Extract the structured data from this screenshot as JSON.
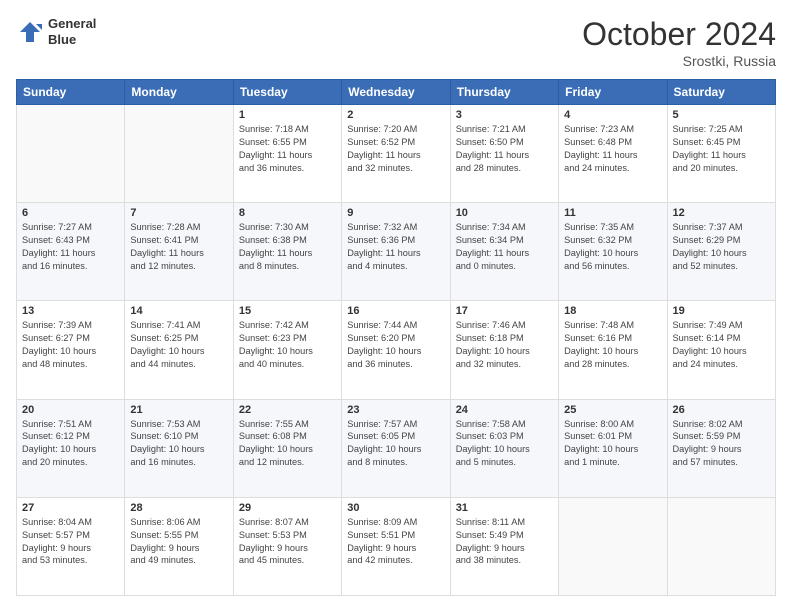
{
  "logo": {
    "line1": "General",
    "line2": "Blue"
  },
  "title": "October 2024",
  "location": "Srostki, Russia",
  "days_header": [
    "Sunday",
    "Monday",
    "Tuesday",
    "Wednesday",
    "Thursday",
    "Friday",
    "Saturday"
  ],
  "weeks": [
    [
      {
        "day": "",
        "info": ""
      },
      {
        "day": "",
        "info": ""
      },
      {
        "day": "1",
        "info": "Sunrise: 7:18 AM\nSunset: 6:55 PM\nDaylight: 11 hours\nand 36 minutes."
      },
      {
        "day": "2",
        "info": "Sunrise: 7:20 AM\nSunset: 6:52 PM\nDaylight: 11 hours\nand 32 minutes."
      },
      {
        "day": "3",
        "info": "Sunrise: 7:21 AM\nSunset: 6:50 PM\nDaylight: 11 hours\nand 28 minutes."
      },
      {
        "day": "4",
        "info": "Sunrise: 7:23 AM\nSunset: 6:48 PM\nDaylight: 11 hours\nand 24 minutes."
      },
      {
        "day": "5",
        "info": "Sunrise: 7:25 AM\nSunset: 6:45 PM\nDaylight: 11 hours\nand 20 minutes."
      }
    ],
    [
      {
        "day": "6",
        "info": "Sunrise: 7:27 AM\nSunset: 6:43 PM\nDaylight: 11 hours\nand 16 minutes."
      },
      {
        "day": "7",
        "info": "Sunrise: 7:28 AM\nSunset: 6:41 PM\nDaylight: 11 hours\nand 12 minutes."
      },
      {
        "day": "8",
        "info": "Sunrise: 7:30 AM\nSunset: 6:38 PM\nDaylight: 11 hours\nand 8 minutes."
      },
      {
        "day": "9",
        "info": "Sunrise: 7:32 AM\nSunset: 6:36 PM\nDaylight: 11 hours\nand 4 minutes."
      },
      {
        "day": "10",
        "info": "Sunrise: 7:34 AM\nSunset: 6:34 PM\nDaylight: 11 hours\nand 0 minutes."
      },
      {
        "day": "11",
        "info": "Sunrise: 7:35 AM\nSunset: 6:32 PM\nDaylight: 10 hours\nand 56 minutes."
      },
      {
        "day": "12",
        "info": "Sunrise: 7:37 AM\nSunset: 6:29 PM\nDaylight: 10 hours\nand 52 minutes."
      }
    ],
    [
      {
        "day": "13",
        "info": "Sunrise: 7:39 AM\nSunset: 6:27 PM\nDaylight: 10 hours\nand 48 minutes."
      },
      {
        "day": "14",
        "info": "Sunrise: 7:41 AM\nSunset: 6:25 PM\nDaylight: 10 hours\nand 44 minutes."
      },
      {
        "day": "15",
        "info": "Sunrise: 7:42 AM\nSunset: 6:23 PM\nDaylight: 10 hours\nand 40 minutes."
      },
      {
        "day": "16",
        "info": "Sunrise: 7:44 AM\nSunset: 6:20 PM\nDaylight: 10 hours\nand 36 minutes."
      },
      {
        "day": "17",
        "info": "Sunrise: 7:46 AM\nSunset: 6:18 PM\nDaylight: 10 hours\nand 32 minutes."
      },
      {
        "day": "18",
        "info": "Sunrise: 7:48 AM\nSunset: 6:16 PM\nDaylight: 10 hours\nand 28 minutes."
      },
      {
        "day": "19",
        "info": "Sunrise: 7:49 AM\nSunset: 6:14 PM\nDaylight: 10 hours\nand 24 minutes."
      }
    ],
    [
      {
        "day": "20",
        "info": "Sunrise: 7:51 AM\nSunset: 6:12 PM\nDaylight: 10 hours\nand 20 minutes."
      },
      {
        "day": "21",
        "info": "Sunrise: 7:53 AM\nSunset: 6:10 PM\nDaylight: 10 hours\nand 16 minutes."
      },
      {
        "day": "22",
        "info": "Sunrise: 7:55 AM\nSunset: 6:08 PM\nDaylight: 10 hours\nand 12 minutes."
      },
      {
        "day": "23",
        "info": "Sunrise: 7:57 AM\nSunset: 6:05 PM\nDaylight: 10 hours\nand 8 minutes."
      },
      {
        "day": "24",
        "info": "Sunrise: 7:58 AM\nSunset: 6:03 PM\nDaylight: 10 hours\nand 5 minutes."
      },
      {
        "day": "25",
        "info": "Sunrise: 8:00 AM\nSunset: 6:01 PM\nDaylight: 10 hours\nand 1 minute."
      },
      {
        "day": "26",
        "info": "Sunrise: 8:02 AM\nSunset: 5:59 PM\nDaylight: 9 hours\nand 57 minutes."
      }
    ],
    [
      {
        "day": "27",
        "info": "Sunrise: 8:04 AM\nSunset: 5:57 PM\nDaylight: 9 hours\nand 53 minutes."
      },
      {
        "day": "28",
        "info": "Sunrise: 8:06 AM\nSunset: 5:55 PM\nDaylight: 9 hours\nand 49 minutes."
      },
      {
        "day": "29",
        "info": "Sunrise: 8:07 AM\nSunset: 5:53 PM\nDaylight: 9 hours\nand 45 minutes."
      },
      {
        "day": "30",
        "info": "Sunrise: 8:09 AM\nSunset: 5:51 PM\nDaylight: 9 hours\nand 42 minutes."
      },
      {
        "day": "31",
        "info": "Sunrise: 8:11 AM\nSunset: 5:49 PM\nDaylight: 9 hours\nand 38 minutes."
      },
      {
        "day": "",
        "info": ""
      },
      {
        "day": "",
        "info": ""
      }
    ]
  ]
}
